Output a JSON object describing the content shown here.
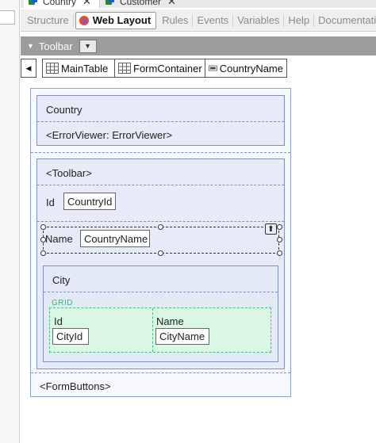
{
  "doc_tabs": [
    {
      "label": "Country",
      "close": "✕"
    },
    {
      "label": "Customer",
      "close": "✕"
    }
  ],
  "editor_tabs": [
    {
      "label": "Structure"
    },
    {
      "label": "Web Layout",
      "active": true
    },
    {
      "label": "Rules"
    },
    {
      "label": "Events"
    },
    {
      "label": "Variables"
    },
    {
      "label": "Help"
    },
    {
      "label": "Documentation"
    }
  ],
  "toolbar": {
    "label": "Toolbar"
  },
  "breadcrumb": [
    {
      "label": "MainTable",
      "icon": "table-icon"
    },
    {
      "label": "FormContainer",
      "icon": "table-icon"
    },
    {
      "label": "CountryName",
      "icon": "textbox-icon"
    }
  ],
  "form": {
    "title": "Country",
    "error_viewer": "<ErrorViewer: ErrorViewer>",
    "toolbar_placeholder": "<Toolbar>",
    "id_label": "Id",
    "id_field": "CountryId",
    "name_label": "Name",
    "name_field": "CountryName",
    "city_title": "City",
    "grid_label": "GRID",
    "grid_col1_label": "Id",
    "grid_col1_field": "CityId",
    "grid_col2_label": "Name",
    "grid_col2_field": "CityName",
    "form_buttons": "<FormButtons>"
  },
  "colors": {
    "canvas_panel": "#e7ebf8",
    "panel_border": "#7f93b9",
    "grid_fill": "#d9f7e3",
    "grid_border": "#4db88a",
    "toolbar_bg": "#9c9c9c"
  }
}
